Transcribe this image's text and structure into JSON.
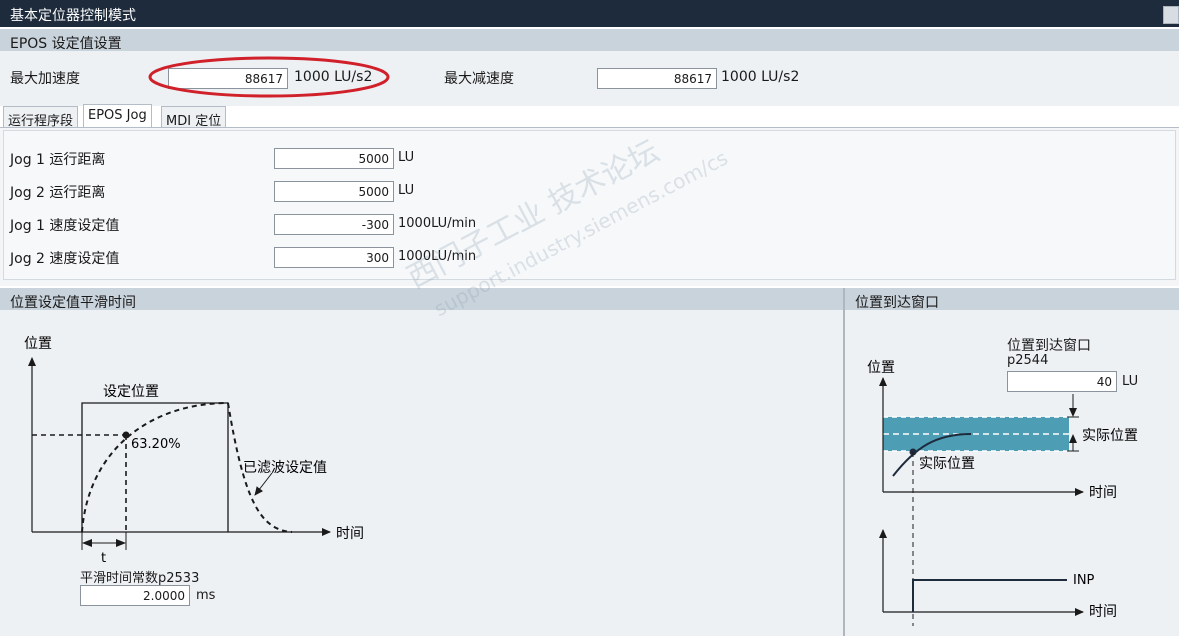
{
  "window": {
    "title": "基本定位器控制模式"
  },
  "setpoint_section": {
    "title": "EPOS 设定值设置",
    "max_accel": {
      "label": "最大加速度",
      "value": "88617",
      "unit": "1000 LU/s2"
    },
    "max_decel": {
      "label": "最大减速度",
      "value": "88617",
      "unit": "1000 LU/s2"
    }
  },
  "tabs": [
    {
      "label": "运行程序段"
    },
    {
      "label": "EPOS Jog"
    },
    {
      "label": "MDI 定位"
    }
  ],
  "jog": {
    "rows": [
      {
        "label": "Jog 1 运行距离",
        "value": "5000",
        "unit": "LU"
      },
      {
        "label": "Jog 2 运行距离",
        "value": "5000",
        "unit": "LU"
      },
      {
        "label": "Jog 1 速度设定值",
        "value": "-300",
        "unit": "1000LU/min"
      },
      {
        "label": "Jog 2 速度设定值",
        "value": "300",
        "unit": "1000LU/min"
      }
    ]
  },
  "smoothing": {
    "title": "位置设定值平滑时间",
    "y_axis_label": "位置",
    "x_axis_label": "时间",
    "setpoint_label": "设定位置",
    "percent_label": "63.20%",
    "filtered_label": "已滤波设定值",
    "t_label": "t",
    "param_label": "平滑时间常数p2533",
    "param_value": "2.0000",
    "param_unit": "ms"
  },
  "window_panel": {
    "title": "位置到达窗口",
    "param_label_line1": "位置到达窗口",
    "param_label_line2": "p2544",
    "param_value": "40",
    "param_unit": "LU",
    "y_axis_label": "位置",
    "x_axis_label": "时间",
    "actual_pos_right": "实际位置",
    "actual_pos_curve": "实际位置",
    "inp_label": "INP",
    "x_axis_label_bottom": "时间"
  },
  "watermark": {
    "line1": "西门子工业 技术论坛",
    "line2": "support.industry.siemens.com/cs"
  },
  "colors": {
    "titlebar": "#1e2b3c",
    "section_header": "#c9d3dc",
    "panel": "#eef1f4",
    "band": "#4d9db5",
    "highlight": "#d0202a"
  }
}
